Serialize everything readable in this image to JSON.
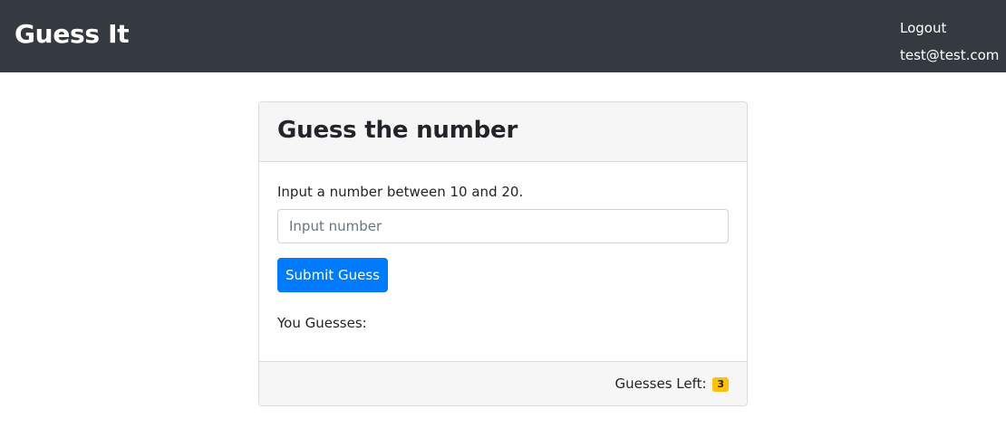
{
  "navbar": {
    "brand": "Guess It",
    "logout_label": "Logout",
    "user_email": "test@test.com",
    "background_color": "#343a40"
  },
  "card": {
    "title": "Guess the number",
    "instructions": "Input a number between 10 and 20.",
    "input": {
      "placeholder": "Input number",
      "value": ""
    },
    "submit_label": "Submit Guess",
    "guesses_label": "You Guesses:",
    "footer": {
      "guesses_left_label": "Guesses Left:",
      "guesses_left_count": "3"
    }
  },
  "colors": {
    "primary_button": "#007bff",
    "badge_warning": "#ffc107"
  }
}
